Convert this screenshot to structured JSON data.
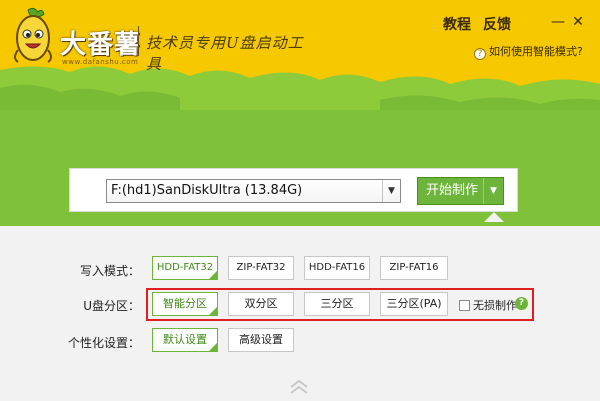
{
  "header": {
    "brand_name": "大番薯",
    "brand_url": "www.dafanshu.com",
    "slogan": "技术员专用U盘启动工具",
    "links": [
      "教程",
      "反馈"
    ],
    "smart_mode_label": "如何使用智能模式?"
  },
  "window_controls": {
    "minimize": "—",
    "close": "✕"
  },
  "device": {
    "selected": "F:(hd1)SanDiskUltra (13.84G)",
    "start_label": "开始制作"
  },
  "write_mode": {
    "label": "写入模式：",
    "options": [
      "HDD-FAT32",
      "ZIP-FAT32",
      "HDD-FAT16",
      "ZIP-FAT16"
    ],
    "selected": "HDD-FAT32"
  },
  "partition": {
    "label": "U盘分区：",
    "options": [
      "智能分区",
      "双分区",
      "三分区",
      "三分区(PA)"
    ],
    "selected": "智能分区",
    "lossless_label": "无损制作"
  },
  "personalize": {
    "label": "个性化设置：",
    "options": [
      "默认设置",
      "高级设置"
    ],
    "selected": "默认设置"
  },
  "colors": {
    "banner_yellow": "#f5c800",
    "grass_green": "#79bb35",
    "accent_green": "#6db53a",
    "highlight_red": "#e02020"
  }
}
